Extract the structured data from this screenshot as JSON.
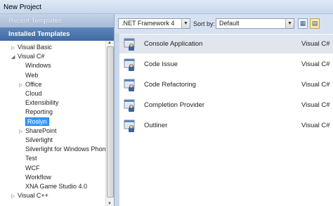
{
  "window": {
    "title": "New Project"
  },
  "left": {
    "recent_header": "Recent Templates",
    "installed_header": "Installed Templates",
    "tree": [
      {
        "label": "Visual Basic",
        "arrow": "▷",
        "indent": 1
      },
      {
        "label": "Visual C#",
        "arrow": "◢",
        "indent": 1
      },
      {
        "label": "Windows",
        "arrow": "",
        "indent": 2
      },
      {
        "label": "Web",
        "arrow": "",
        "indent": 2
      },
      {
        "label": "Office",
        "arrow": "▷",
        "indent": 2
      },
      {
        "label": "Cloud",
        "arrow": "",
        "indent": 2
      },
      {
        "label": "Extensibility",
        "arrow": "",
        "indent": 2
      },
      {
        "label": "Reporting",
        "arrow": "",
        "indent": 2
      },
      {
        "label": "Roslyn",
        "arrow": "",
        "indent": 2,
        "selected": true
      },
      {
        "label": "SharePoint",
        "arrow": "▷",
        "indent": 2
      },
      {
        "label": "Silverlight",
        "arrow": "",
        "indent": 2
      },
      {
        "label": "Silverlight for Windows Phone",
        "arrow": "",
        "indent": 2
      },
      {
        "label": "Test",
        "arrow": "",
        "indent": 2
      },
      {
        "label": "WCF",
        "arrow": "",
        "indent": 2
      },
      {
        "label": "Workflow",
        "arrow": "",
        "indent": 2
      },
      {
        "label": "XNA Game Studio 4.0",
        "arrow": "",
        "indent": 2
      },
      {
        "label": "Visual C++",
        "arrow": "▷",
        "indent": 1
      }
    ]
  },
  "toolbar": {
    "framework": ".NET Framework 4",
    "sort_label": "Sort by:",
    "sort_value": "Default"
  },
  "templates": [
    {
      "name": "Console Application",
      "language": "Visual C#",
      "selected": true
    },
    {
      "name": "Code Issue",
      "language": "Visual C#"
    },
    {
      "name": "Code Refactoring",
      "language": "Visual C#"
    },
    {
      "name": "Completion Provider",
      "language": "Visual C#"
    },
    {
      "name": "Outliner",
      "language": "Visual C#"
    }
  ],
  "colors": {
    "accent": "#3399ff",
    "header": "#4a74ab"
  }
}
